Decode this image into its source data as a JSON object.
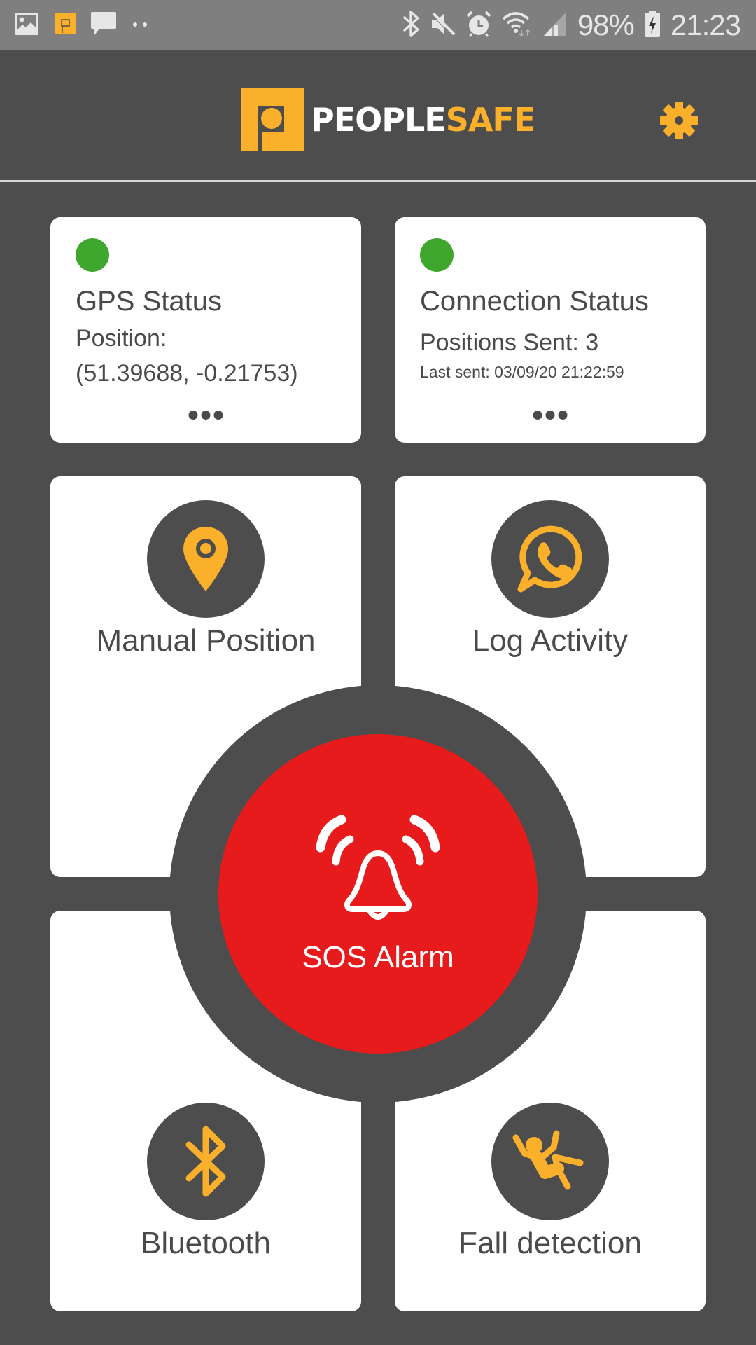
{
  "status_bar": {
    "left_icons": [
      "gallery-icon",
      "peoplesafe-app-icon",
      "message-icon",
      "more-notifications-icon"
    ],
    "right_icons": [
      "bluetooth-icon",
      "mute-icon",
      "alarm-icon",
      "wifi-icon",
      "signal-icon"
    ],
    "battery_percent": "98%",
    "battery_icon": "battery-charging-icon",
    "time": "21:23"
  },
  "header": {
    "logo_text_white": "PEOPLE",
    "logo_text_yellow": "SAFE",
    "settings_icon": "gear-icon"
  },
  "colors": {
    "accent": "#fbb02c",
    "background": "#4d4d4d",
    "card": "#ffffff",
    "status_ok": "#3fa72d",
    "sos": "#e81b1c",
    "text": "#4a4a4a",
    "status_bar": "#7f7f7f"
  },
  "gps_card": {
    "status": "ok",
    "title": "GPS Status",
    "line1": "Position:",
    "line2": "(51.39688, -0.21753)",
    "more_icon": "more-horizontal-icon"
  },
  "connection_card": {
    "status": "ok",
    "title": "Connection Status",
    "line1": "Positions Sent: 3",
    "line2": "Last sent: 03/09/20 21:22:59",
    "more_icon": "more-horizontal-icon"
  },
  "tiles": [
    {
      "label": "Manual Position",
      "icon": "map-pin-icon"
    },
    {
      "label": "Log Activity",
      "icon": "phone-chat-icon"
    },
    {
      "label": "Bluetooth",
      "icon": "bluetooth-icon"
    },
    {
      "label": "Fall detection",
      "icon": "fall-person-icon"
    }
  ],
  "sos": {
    "label": "SOS Alarm",
    "icon": "alarm-bell-icon"
  }
}
